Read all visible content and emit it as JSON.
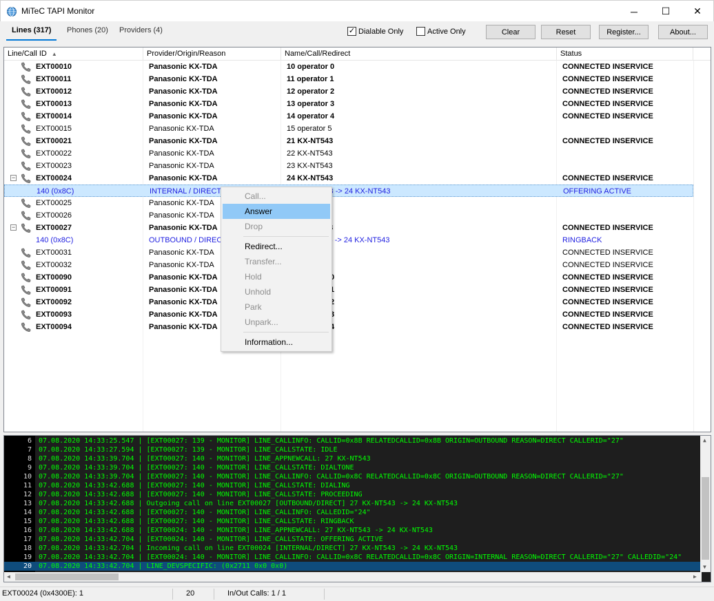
{
  "window": {
    "title": "MiTeC TAPI Monitor",
    "icon": "globe-icon",
    "controls": {
      "minimize": "─",
      "maximize": "☐",
      "close": "✕"
    }
  },
  "tabs": [
    {
      "label": "Lines (317)",
      "active": true
    },
    {
      "label": "Phones (20)",
      "active": false
    },
    {
      "label": "Providers (4)",
      "active": false
    }
  ],
  "filters": {
    "dialable_only": {
      "label": "Dialable Only",
      "checked": true,
      "mark": "✓"
    },
    "active_only": {
      "label": "Active Only",
      "checked": false
    }
  },
  "buttons": {
    "clear": "Clear",
    "reset": "Reset",
    "register": "Register...",
    "about": "About..."
  },
  "columns": {
    "line": "Line/Call ID",
    "sort_glyph": "▲",
    "provider": "Provider/Origin/Reason",
    "name": "Name/Call/Redirect",
    "status": "Status"
  },
  "rows": [
    {
      "id": "EXT00010",
      "provider": "Panasonic KX-TDA",
      "name": "10 operator 0",
      "status": "CONNECTED INSERVICE",
      "bold": true
    },
    {
      "id": "EXT00011",
      "provider": "Panasonic KX-TDA",
      "name": "11 operator 1",
      "status": "CONNECTED INSERVICE",
      "bold": true
    },
    {
      "id": "EXT00012",
      "provider": "Panasonic KX-TDA",
      "name": "12 operator 2",
      "status": "CONNECTED INSERVICE",
      "bold": true
    },
    {
      "id": "EXT00013",
      "provider": "Panasonic KX-TDA",
      "name": "13 operator 3",
      "status": "CONNECTED INSERVICE",
      "bold": true
    },
    {
      "id": "EXT00014",
      "provider": "Panasonic KX-TDA",
      "name": "14 operator 4",
      "status": "CONNECTED INSERVICE",
      "bold": true
    },
    {
      "id": "EXT00015",
      "provider": "Panasonic KX-TDA",
      "name": "15 operator 5",
      "status": "",
      "bold": false
    },
    {
      "id": "EXT00021",
      "provider": "Panasonic KX-TDA",
      "name": "21 KX-NT543",
      "status": "CONNECTED INSERVICE",
      "bold": true
    },
    {
      "id": "EXT00022",
      "provider": "Panasonic KX-TDA",
      "name": "22 KX-NT543",
      "status": "",
      "bold": false
    },
    {
      "id": "EXT00023",
      "provider": "Panasonic KX-TDA",
      "name": "23 KX-NT543",
      "status": "",
      "bold": false
    },
    {
      "id": "EXT00024",
      "provider": "Panasonic KX-TDA",
      "name": "24 KX-NT543",
      "status": "CONNECTED INSERVICE",
      "bold": true,
      "expand": "−"
    },
    {
      "id": "140 (0x8C)",
      "provider": "INTERNAL / DIRECT",
      "name": "27 KX-NT543 -> 24 KX-NT543",
      "status": "OFFERING ACTIVE",
      "call": true,
      "selected": true
    },
    {
      "id": "EXT00025",
      "provider": "Panasonic KX-TDA",
      "name": "",
      "status": "",
      "bold": false
    },
    {
      "id": "EXT00026",
      "provider": "Panasonic KX-TDA",
      "name": "",
      "status": "",
      "bold": false
    },
    {
      "id": "EXT00027",
      "provider": "Panasonic KX-TDA",
      "name": "27 KX-NT543",
      "status": "CONNECTED INSERVICE",
      "bold": true,
      "expand": "−"
    },
    {
      "id": "140 (0x8C)",
      "provider": "OUTBOUND / DIRECT",
      "name": "27 KX-NT543 -> 24 KX-NT543",
      "status": "RINGBACK",
      "call": true
    },
    {
      "id": "EXT00031",
      "provider": "Panasonic KX-TDA",
      "name": "31 Lobby",
      "status": "CONNECTED INSERVICE",
      "bold": false
    },
    {
      "id": "EXT00032",
      "provider": "Panasonic KX-TDA",
      "name": "32 Lobby",
      "status": "CONNECTED INSERVICE",
      "bold": false
    },
    {
      "id": "EXT00090",
      "provider": "Panasonic KX-TDA",
      "name": "90 operator 0",
      "status": "CONNECTED INSERVICE",
      "bold": true
    },
    {
      "id": "EXT00091",
      "provider": "Panasonic KX-TDA",
      "name": "91 operator 1",
      "status": "CONNECTED INSERVICE",
      "bold": true
    },
    {
      "id": "EXT00092",
      "provider": "Panasonic KX-TDA",
      "name": "92 operator 2",
      "status": "CONNECTED INSERVICE",
      "bold": true
    },
    {
      "id": "EXT00093",
      "provider": "Panasonic KX-TDA",
      "name": "93 operator 3",
      "status": "CONNECTED INSERVICE",
      "bold": true
    },
    {
      "id": "EXT00094",
      "provider": "Panasonic KX-TDA",
      "name": "94 operator 4",
      "status": "CONNECTED INSERVICE",
      "bold": true
    }
  ],
  "context_menu": [
    {
      "label": "Call...",
      "enabled": false
    },
    {
      "label": "Answer",
      "enabled": true,
      "highlighted": true
    },
    {
      "label": "Drop",
      "enabled": false
    },
    {
      "separator": true
    },
    {
      "label": "Redirect...",
      "enabled": true
    },
    {
      "label": "Transfer...",
      "enabled": false
    },
    {
      "label": "Hold",
      "enabled": false
    },
    {
      "label": "Unhold",
      "enabled": false
    },
    {
      "label": "Park",
      "enabled": false
    },
    {
      "label": "Unpark...",
      "enabled": false
    },
    {
      "separator": true
    },
    {
      "label": "Information...",
      "enabled": true
    }
  ],
  "log": [
    {
      "n": "6",
      "text": "07.08.2020 14:33:25.547 | [EXT00027: 139 - MONITOR] LINE_CALLINFO: CALLID=0x8B RELATEDCALLID=0x8B ORIGIN=OUTBOUND REASON=DIRECT CALLERID=\"27\""
    },
    {
      "n": "7",
      "text": "07.08.2020 14:33:27.594 | [EXT00027: 139 - MONITOR] LINE_CALLSTATE: IDLE"
    },
    {
      "n": "8",
      "text": "07.08.2020 14:33:39.704 | [EXT00027: 140 - MONITOR] LINE_APPNEWCALL: 27 KX-NT543"
    },
    {
      "n": "9",
      "text": "07.08.2020 14:33:39.704 | [EXT00027: 140 - MONITOR] LINE_CALLSTATE: DIALTONE"
    },
    {
      "n": "10",
      "text": "07.08.2020 14:33:39.704 | [EXT00027: 140 - MONITOR] LINE_CALLINFO: CALLID=0x8C RELATEDCALLID=0x8C ORIGIN=OUTBOUND REASON=DIRECT CALLERID=\"27\""
    },
    {
      "n": "11",
      "text": "07.08.2020 14:33:42.688 | [EXT00027: 140 - MONITOR] LINE_CALLSTATE: DIALING"
    },
    {
      "n": "12",
      "text": "07.08.2020 14:33:42.688 | [EXT00027: 140 - MONITOR] LINE_CALLSTATE: PROCEEDING"
    },
    {
      "n": "13",
      "text": "07.08.2020 14:33:42.688 | Outgoing call on line EXT00027 [OUTBOUND/DIRECT] 27 KX-NT543 -> 24 KX-NT543"
    },
    {
      "n": "14",
      "text": "07.08.2020 14:33:42.688 | [EXT00027: 140 - MONITOR] LINE_CALLINFO: CALLEDID=\"24\""
    },
    {
      "n": "15",
      "text": "07.08.2020 14:33:42.688 | [EXT00027: 140 - MONITOR] LINE_CALLSTATE: RINGBACK"
    },
    {
      "n": "16",
      "text": "07.08.2020 14:33:42.688 | [EXT00024: 140 - MONITOR] LINE_APPNEWCALL: 27 KX-NT543 -> 24 KX-NT543"
    },
    {
      "n": "17",
      "text": "07.08.2020 14:33:42.704 | [EXT00024: 140 - MONITOR] LINE_CALLSTATE: OFFERING ACTIVE"
    },
    {
      "n": "18",
      "text": "07.08.2020 14:33:42.704 | Incoming call on line EXT00024 [INTERNAL/DIRECT] 27 KX-NT543 -> 24 KX-NT543"
    },
    {
      "n": "19",
      "text": "07.08.2020 14:33:42.704 | [EXT00024: 140 - MONITOR] LINE_CALLINFO: CALLID=0x8C RELATEDCALLID=0x8C ORIGIN=INTERNAL REASON=DIRECT CALLERID=\"27\" CALLEDID=\"24\""
    },
    {
      "n": "20",
      "text": "07.08.2020 14:33:42.704 | LINE_DEVSPECIFIC: (0x2711 0x0 0x0)",
      "current": true
    }
  ],
  "statusbar": {
    "line": "EXT00024 (0x4300E): 1",
    "count": "20",
    "calls": "In/Out Calls: 1 / 1"
  }
}
